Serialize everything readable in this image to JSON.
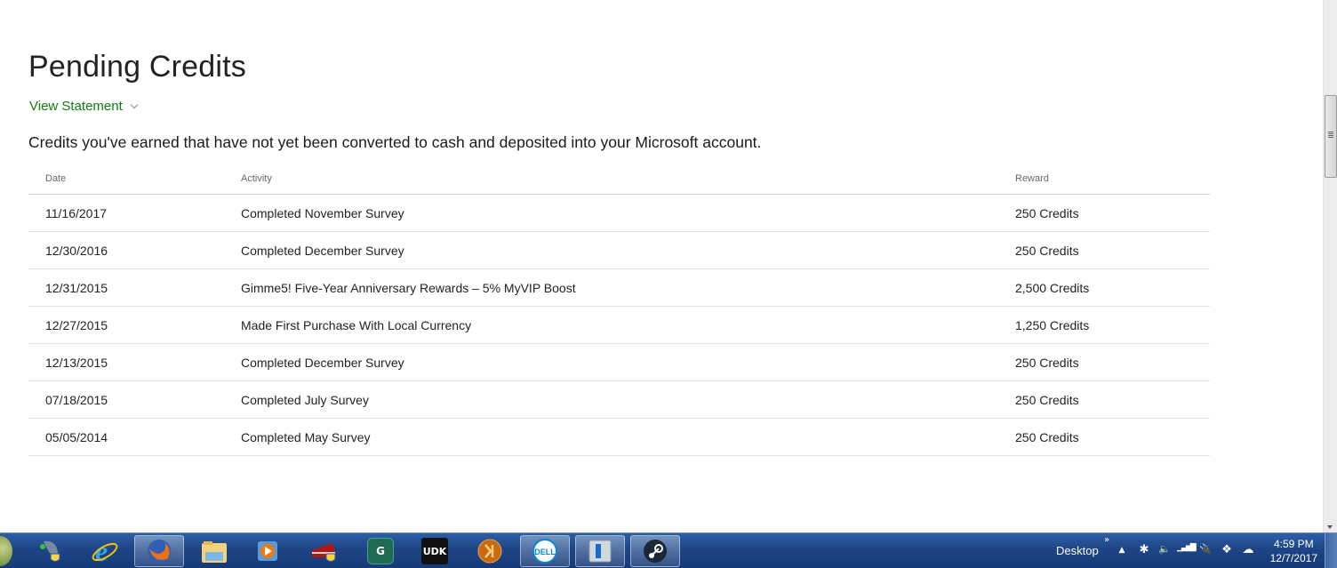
{
  "page": {
    "title": "Pending Credits",
    "view_statement_label": "View Statement",
    "description": "Credits you've earned that have not yet been converted to cash and deposited into your Microsoft account.",
    "accent_color": "#107c10"
  },
  "table": {
    "headers": {
      "date": "Date",
      "activity": "Activity",
      "reward": "Reward"
    },
    "rows": [
      {
        "date": "11/16/2017",
        "activity": "Completed November Survey",
        "reward": "250 Credits"
      },
      {
        "date": "12/30/2016",
        "activity": "Completed December Survey",
        "reward": "250 Credits"
      },
      {
        "date": "12/31/2015",
        "activity": "Gimme5! Five-Year Anniversary Rewards – 5% MyVIP Boost",
        "reward": "2,500 Credits"
      },
      {
        "date": "12/27/2015",
        "activity": "Made First Purchase With Local Currency",
        "reward": "1,250 Credits"
      },
      {
        "date": "12/13/2015",
        "activity": "Completed December Survey",
        "reward": "250 Credits"
      },
      {
        "date": "07/18/2015",
        "activity": "Completed July Survey",
        "reward": "250 Credits"
      },
      {
        "date": "05/05/2014",
        "activity": "Completed May Survey",
        "reward": "250 Credits"
      }
    ]
  },
  "taskbar": {
    "apps": [
      {
        "name": "network-shield-icon",
        "glyph": "🛡"
      },
      {
        "name": "internet-explorer-icon",
        "glyph": "e"
      },
      {
        "name": "firefox-icon",
        "glyph": ""
      },
      {
        "name": "file-explorer-icon",
        "glyph": ""
      },
      {
        "name": "media-player-icon",
        "glyph": "▶"
      },
      {
        "name": "cake-shield-icon",
        "glyph": ""
      },
      {
        "name": "3ds-max-icon",
        "glyph": "G"
      },
      {
        "name": "udk-icon",
        "glyph": "UDK"
      },
      {
        "name": "swtor-icon",
        "glyph": ""
      },
      {
        "name": "dell-icon",
        "glyph": "DELL"
      },
      {
        "name": "app-window-icon",
        "glyph": ""
      },
      {
        "name": "steam-icon",
        "glyph": ""
      }
    ],
    "desktop_label": "Desktop",
    "toolbar_overflow": "»",
    "tray_icons": {
      "show_hidden": "▲",
      "bluetooth": "✱",
      "volume": "🔈",
      "signal": "▁▃▅▇",
      "power": "🔌",
      "dropbox": "❖",
      "cloud": "☁"
    },
    "clock": {
      "time": "4:59 PM",
      "date": "12/7/2017"
    }
  }
}
